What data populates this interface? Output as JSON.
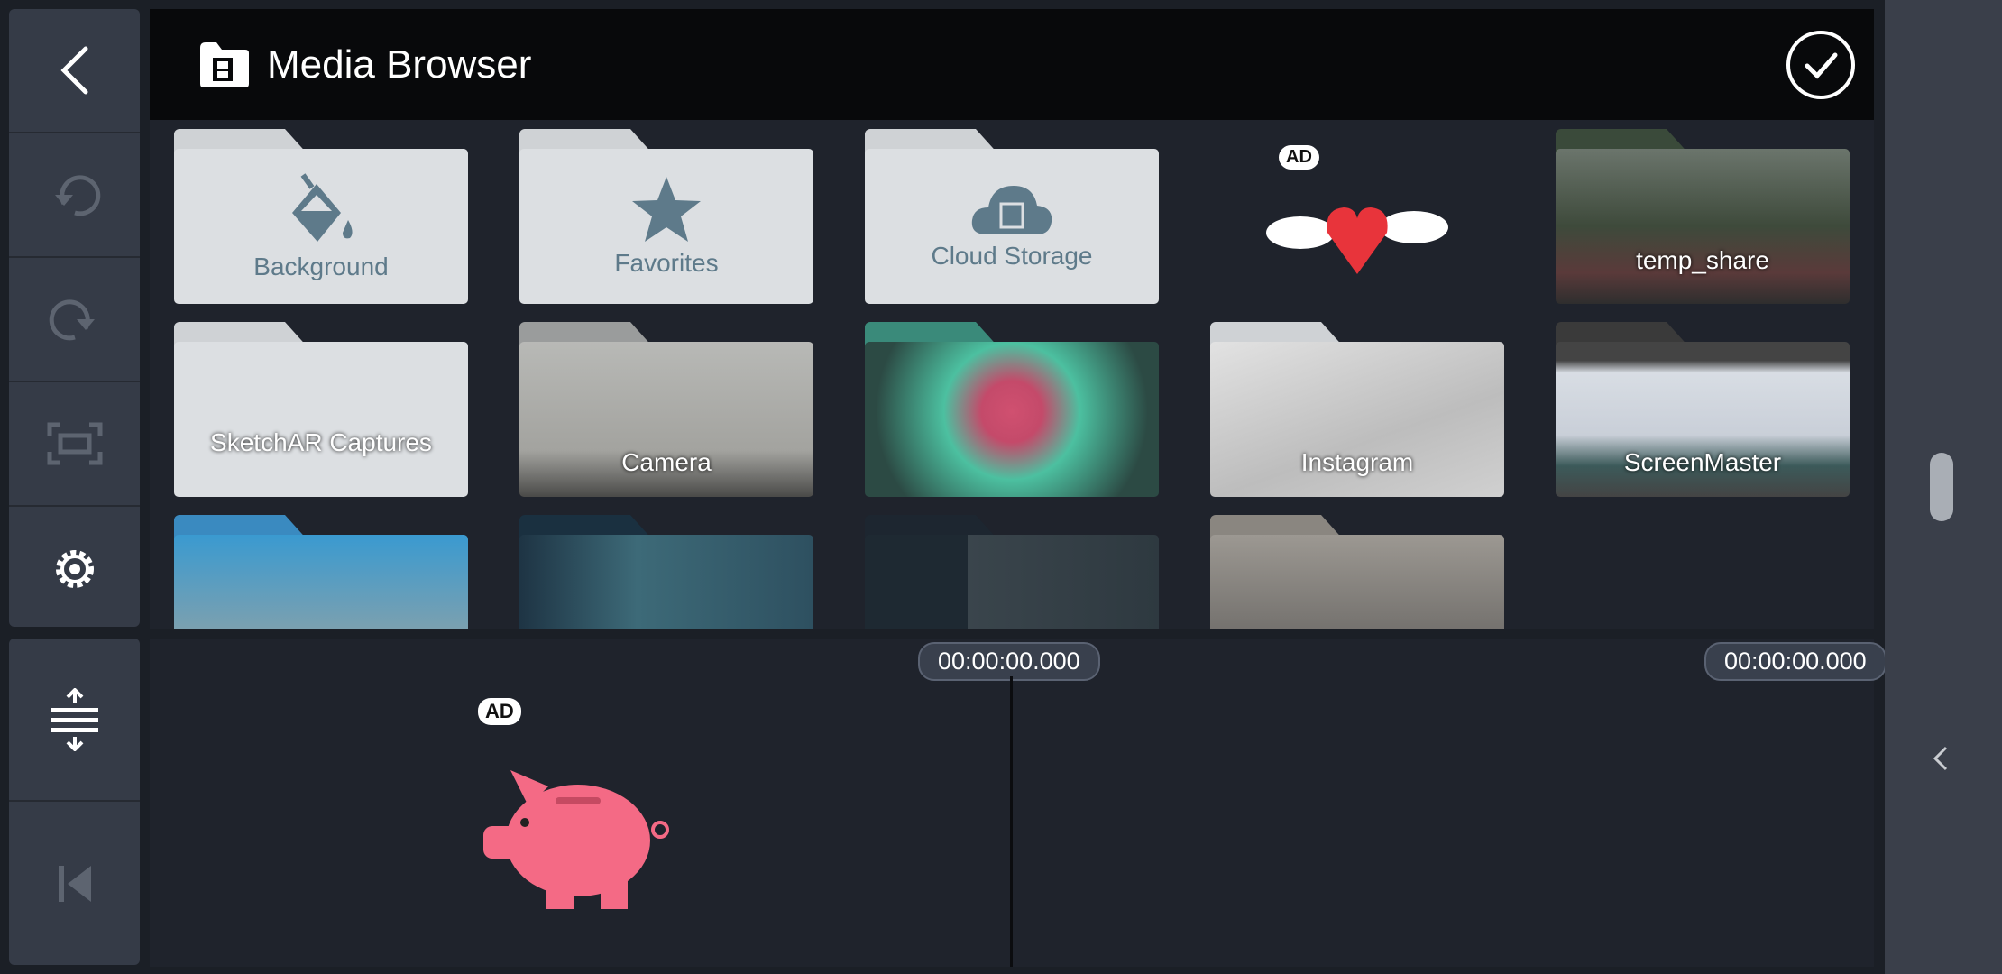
{
  "header": {
    "title": "Media Browser",
    "confirm_icon": "check-circle-icon"
  },
  "sidebar": {
    "items": [
      {
        "icon": "back-icon"
      },
      {
        "icon": "undo-icon"
      },
      {
        "icon": "redo-icon"
      },
      {
        "icon": "fullscreen-icon"
      },
      {
        "icon": "settings-icon"
      }
    ],
    "bottom": [
      {
        "icon": "expand-tracks-icon"
      },
      {
        "icon": "skip-to-start-icon"
      }
    ]
  },
  "folders": [
    {
      "label": "Background",
      "icon": "paint-bucket-icon"
    },
    {
      "label": "Favorites",
      "icon": "star-icon"
    },
    {
      "label": "Cloud Storage",
      "icon": "cloud-film-icon"
    },
    {
      "ad": "AD"
    },
    {
      "label": "temp_share"
    },
    {
      "label": "SketchAR Captures"
    },
    {
      "label": "Camera"
    },
    {
      "label": ""
    },
    {
      "label": "Instagram"
    },
    {
      "label": "ScreenMaster"
    },
    {
      "label": ""
    },
    {
      "label": ""
    },
    {
      "label": ""
    },
    {
      "label": ""
    }
  ],
  "timeline": {
    "current_time": "00:00:00.000",
    "end_time": "00:00:00.000",
    "ad": "AD"
  },
  "colors": {
    "accent_icon": "#5e7a8a",
    "folder": "#dcdfe2",
    "ad_pig": "#f46a85"
  }
}
